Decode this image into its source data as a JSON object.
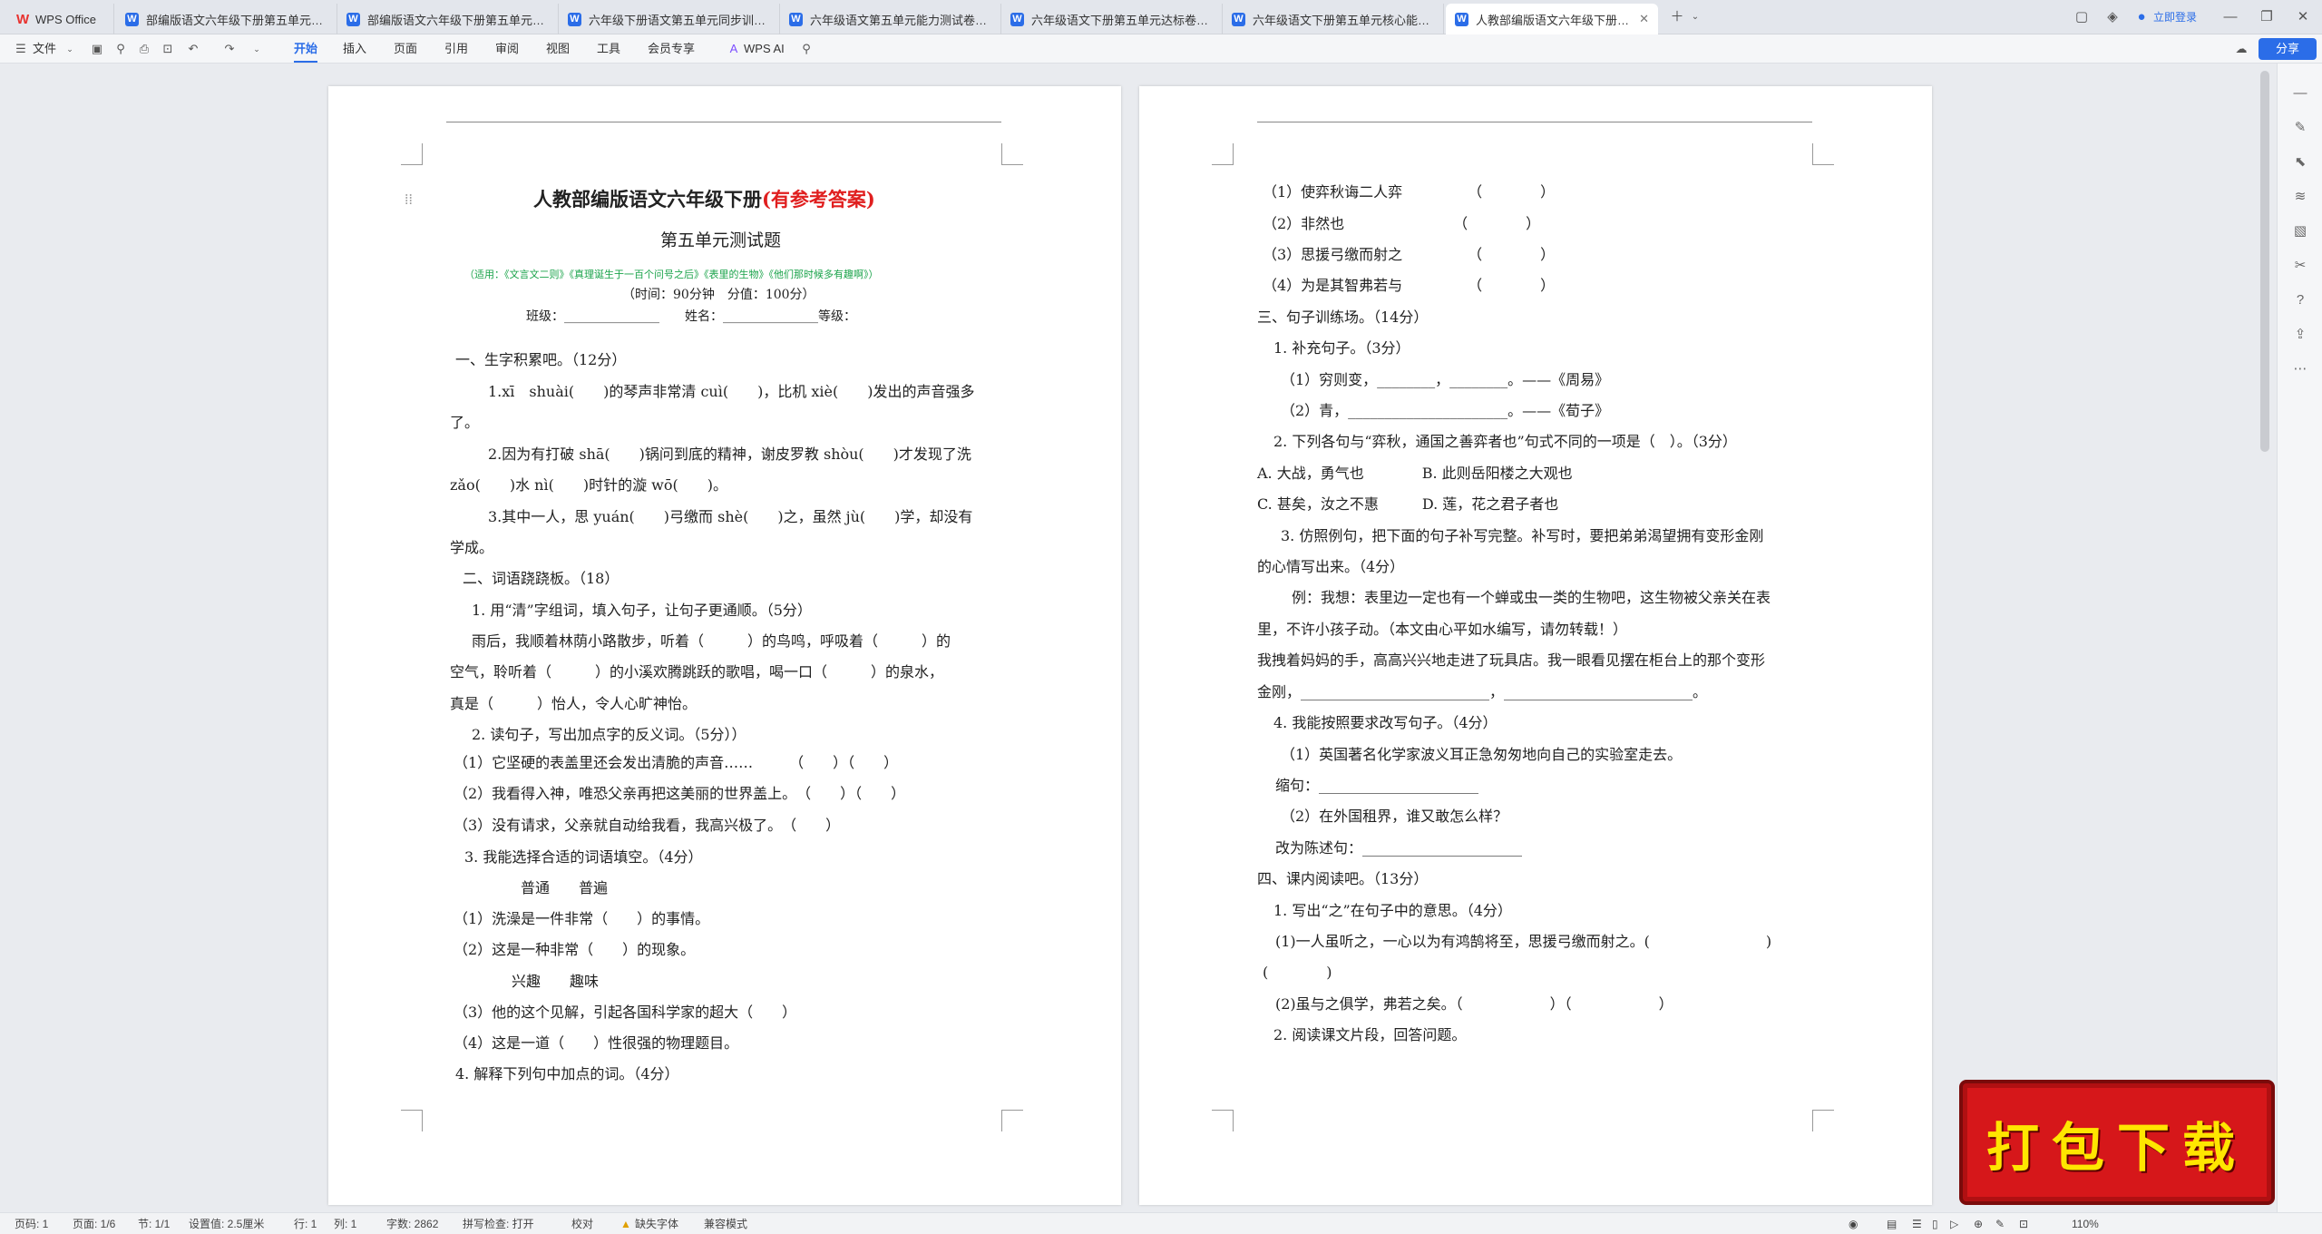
{
  "tabs": [
    {
      "label": "WPS Office"
    },
    {
      "label": "部编版语文六年级下册第五单元综合…"
    },
    {
      "label": "部编版语文六年级下册第五单元综合…"
    },
    {
      "label": "六年级下册语文第五单元同步训练卷…"
    },
    {
      "label": "六年级语文第五单元能力测试卷（有…"
    },
    {
      "label": "六年级语文下册第五单元达标卷（有…"
    },
    {
      "label": "六年级语文下册第五单元核心能力达…"
    },
    {
      "label": "人教部编版语文六年级下册第…"
    }
  ],
  "login": "立即登录",
  "menu": {
    "file": "文件",
    "items": [
      "开始",
      "插入",
      "页面",
      "引用",
      "审阅",
      "视图",
      "工具",
      "会员专享"
    ],
    "wpsai": "WPS AI",
    "share": "分享"
  },
  "doc_left": [
    {
      "t": "人教部编版语文六年级下册",
      "red": "(有参考答案)"
    },
    "第五单元测试题",
    "（适用：《文言文二则》《真理诞生于一百个问号之后》《表里的生物》《他们那时候多有趣啊》）",
    "（时间：90分钟　分值：100分）",
    "班级：_______________　　姓名：_______________等级：",
    "一、生字积累吧。（12分）",
    "1.xī　shuài(　　)的琴声非常清 cuì(　　)，比机 xiè(　　)发出的声音强多",
    "了。",
    "2.因为有打破 shā(　　)锅问到底的精神，谢皮罗教 shòu(　　)才发现了洗",
    "zǎo(　　)水 nì(　　)时针的漩 wō(　　)。",
    "3.其中一人，思 yuán(　　)弓缴而 shè(　　)之，虽然 jù(　　)学，却没有",
    "学成。",
    "二、词语跷跷板。（18）",
    "1. 用“清”字组词，填入句子，让句子更通顺。（5分）",
    "雨后，我顺着林荫小路散步，听着（　　　）的鸟鸣，呼吸着（　　　）的",
    "空气，聆听着（　　　）的小溪欢腾跳跃的歌唱，喝一口（　　　）的泉水，",
    "真是（　　　）怡人，令人心旷神怡。",
    "2. 读句子，写出加点字的反义词。（5分））",
    "（1）它坚硬的表盖里还会发出清脆的声音……　　　（　　）（　　）",
    "（2）我看得入神，唯恐父亲再把这美丽的世界盖上。　（　　）（　　）",
    "（3）没有请求，父亲就自动给我看，我高兴极了。　（　　）",
    "3. 我能选择合适的词语填空。（4分）",
    "普通　　普遍",
    "（1）洗澡是一件非常（　　）的事情。",
    "（2）这是一种非常（　　）的现象。",
    "兴趣　　趣味",
    "（3）他的这个见解，引起各国科学家的超大（　　）",
    "（4）这是一道（　　）性很强的物理题目。",
    "4. 解释下列句中加点的词。（4分）"
  ],
  "doc_right": [
    "（1）使弈秋诲二人弈　　　　　（　　　　）",
    "（2）非然也　　　　　　　　（　　　　）",
    "（3）思援弓缴而射之　　　　　（　　　　）",
    "（4）为是其智弗若与　　　　　（　　　　）",
    "三、句子训练场。（14分）",
    "1. 补充句子。（3分）",
    "（1）穷则变，________，________。——《周易》",
    "（2）青，______________________。——《荀子》",
    "2. 下列各句与“弈秋，通国之善弈者也”句式不同的一项是（　）。（3分）",
    "A. 大战，勇气也　　　　B. 此则岳阳楼之大观也",
    "C. 甚矣，汝之不惠　　　D. 莲，花之君子者也",
    "3. 仿照例句，把下面的句子补写完整。补写时，要把弟弟渴望拥有变形金刚",
    "的心情写出来。（4分）",
    "例：我想：表里边一定也有一个蝉或虫一类的生物吧，这生物被父亲关在表",
    "里，不许小孩子动。（本文由心平如水编写，请勿转载！）",
    "我拽着妈妈的手，高高兴兴地走进了玩具店。我一眼看见摆在柜台上的那个变形",
    "金刚，__________________________，__________________________。",
    "4. 我能按照要求改写句子。（4分）",
    "（1）英国著名化学家波义耳正急匆匆地向自己的实验室走去。",
    "缩句：______________________",
    "（2）在外国租界，谁又敢怎么样？",
    "改为陈述句：______________________",
    "四、课内阅读吧。（13分）",
    "1. 写出“之”在句子中的意思。（4分）",
    "(1)一人虽听之，一心以为有鸿鹄将至，思援弓缴而射之。(　　　　　　　　)",
    "(　　　　)",
    "(2)虽与之俱学，弗若之矣。（　　　　　　）（　　　　　　）",
    "2. 阅读课文片段，回答问题。"
  ],
  "status": {
    "page": "页码: 1",
    "pages": "页面: 1/6",
    "section": "节: 1/1",
    "setting": "设置值: 2.5厘米",
    "row": "行: 1",
    "col": "列: 1",
    "words": "字数: 2862",
    "spell": "拼写检查: 打开",
    "proof": "校对",
    "font": "缺失字体",
    "compat": "兼容模式",
    "zoom": "110%"
  },
  "banner": "打包下载"
}
